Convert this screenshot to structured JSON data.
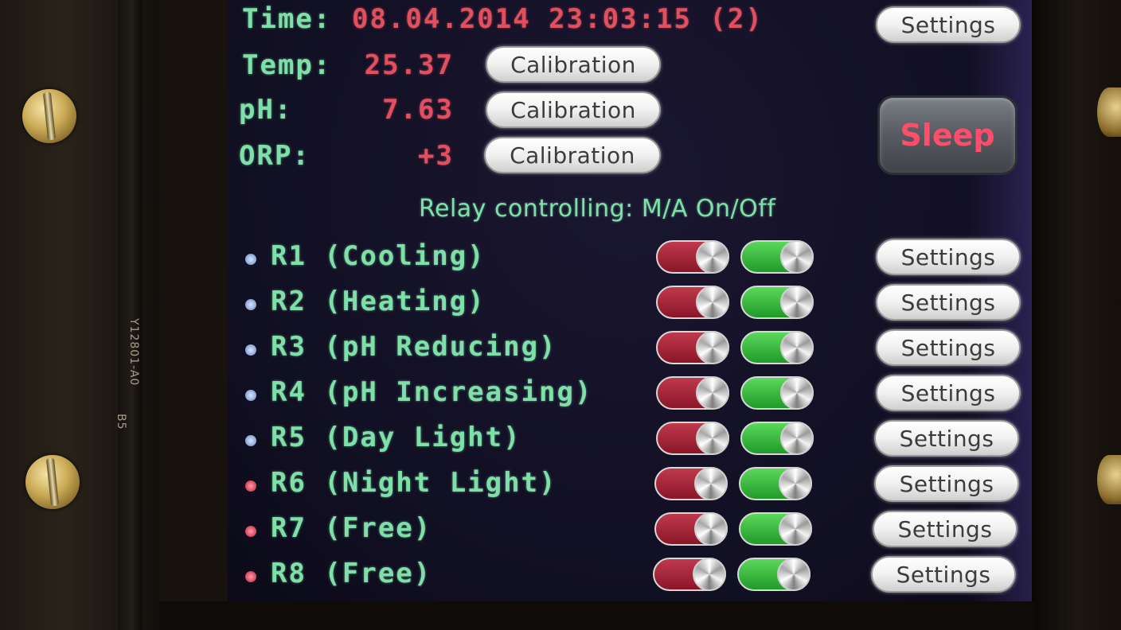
{
  "device": {
    "board_print": "Y12801-A0",
    "board_print_sub": "B5"
  },
  "status": {
    "time_label": "Time:",
    "time_value": "08.04.2014 23:03:15 (2)",
    "temp_label": "Temp:",
    "temp_value": "25.37",
    "ph_label": "pH:",
    "ph_value": "7.63",
    "orp_label": "ORP:",
    "orp_value": "+3",
    "calibration_label": "Calibration",
    "settings_label": "Settings",
    "sleep_label": "Sleep"
  },
  "relay_header": "Relay controlling: M/A On/Off",
  "relays": [
    {
      "label": "R1 (Cooling)",
      "indicator": "blue",
      "settings_label": "Settings"
    },
    {
      "label": "R2 (Heating)",
      "indicator": "blue",
      "settings_label": "Settings"
    },
    {
      "label": "R3 (pH Reducing)",
      "indicator": "blue",
      "settings_label": "Settings"
    },
    {
      "label": "R4 (pH Increasing)",
      "indicator": "blue",
      "settings_label": "Settings"
    },
    {
      "label": "R5 (Day Light)",
      "indicator": "blue",
      "settings_label": "Settings"
    },
    {
      "label": "R6 (Night Light)",
      "indicator": "red",
      "settings_label": "Settings"
    },
    {
      "label": "R7 (Free)",
      "indicator": "red",
      "settings_label": "Settings"
    },
    {
      "label": "R8 (Free)",
      "indicator": "red",
      "settings_label": "Settings"
    }
  ],
  "colors": {
    "label_green": "#7ee0a8",
    "value_red": "#e0505f",
    "toggle_ma": "#b0283d",
    "toggle_onoff": "#3cc043",
    "sleep_text": "#ff4d6a"
  }
}
